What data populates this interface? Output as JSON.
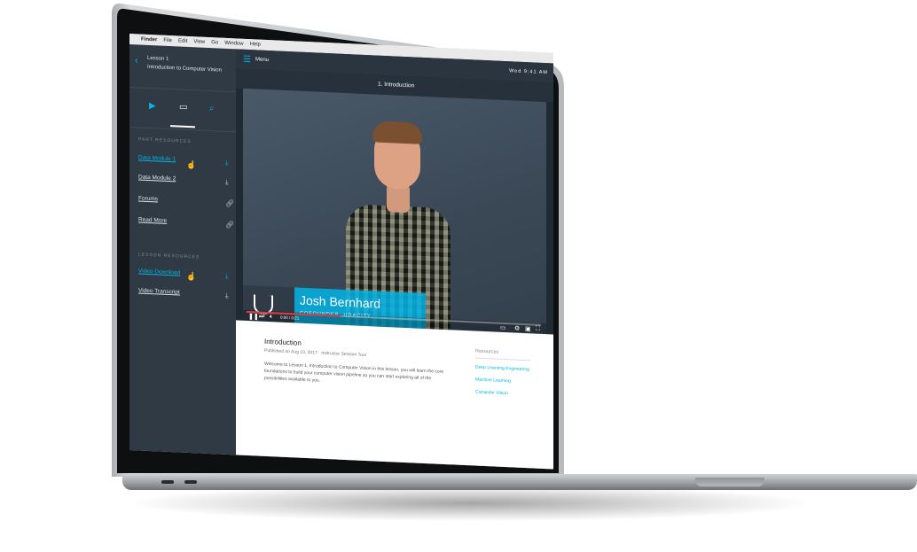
{
  "menubar": {
    "apple": "",
    "app": "Finder",
    "items": [
      "File",
      "Edit",
      "View",
      "Go",
      "Window",
      "Help"
    ]
  },
  "sidebar": {
    "back_icon": "chevron-left-icon",
    "lesson": "Lesson 1",
    "lesson_title": "Introduction to Computer Vision",
    "tabs": [
      "video-icon",
      "document-icon",
      "search-icon"
    ],
    "part_resources_label": "PART RESOURCES",
    "part_resources": [
      {
        "label": "Data Module 1",
        "icon": "download-icon",
        "active": true
      },
      {
        "label": "Data Module 2",
        "icon": "download-icon",
        "active": false
      },
      {
        "label": "Forums",
        "icon": "link-icon",
        "active": false
      },
      {
        "label": "Read More",
        "icon": "link-icon",
        "active": false
      }
    ],
    "lesson_resources_label": "LESSON RESOURCES",
    "lesson_resources": [
      {
        "label": "Video Download",
        "icon": "download-icon",
        "active": true
      },
      {
        "label": "Video Transcript",
        "icon": "download-icon",
        "active": false
      }
    ]
  },
  "topbar": {
    "menu_label": "Menu",
    "status_text": "Wed 9:41 AM"
  },
  "concept_title": "1. Introduction",
  "video": {
    "lower_third_name": "Josh Bernhard",
    "lower_third_role": "COFOUNDER, UDACITY",
    "time": "0:00 / 0:21",
    "progress": 0.32,
    "accent": "#02b3e4",
    "progress_color": "#e03a3e"
  },
  "content": {
    "title": "Introduction",
    "meta": "Published on Aug 10, 2017 · Instructor Session Tour",
    "body": "Welcome to Lesson 1, Introduction to Computer Vision in this lesson, you will learn the core foundations to build your computer vision pipeline so you can start exploring all of the possibilities available to you."
  },
  "resources": {
    "heading": "Resources",
    "items": [
      "Deep Learning Engineering",
      "Machine Learning",
      "Computer Vision"
    ]
  }
}
